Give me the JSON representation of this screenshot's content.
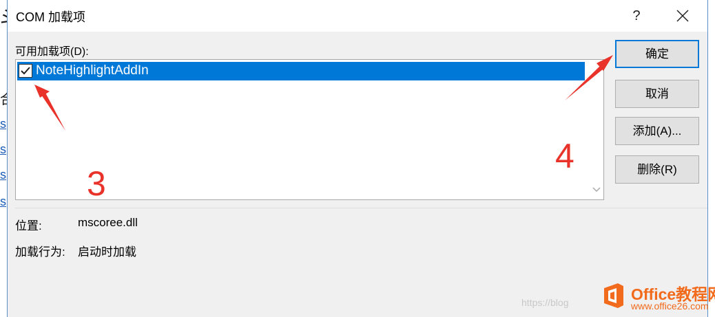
{
  "background": {
    "title_fragment": "斗",
    "text_fragment": "合",
    "link_fragments": [
      "s",
      "s",
      "s",
      "s"
    ]
  },
  "dialog": {
    "title": "COM 加载项",
    "help_label": "?",
    "close_label": "✕",
    "list_label": "可用加载项(D):",
    "items": [
      {
        "label": "NoteHighlightAddIn",
        "checked": true,
        "selected": true
      }
    ],
    "buttons": {
      "ok": "确定",
      "cancel": "取消",
      "add": "添加(A)...",
      "remove": "删除(R)"
    },
    "location_label": "位置:",
    "location_value": "mscoree.dll",
    "load_behavior_label": "加载行为:",
    "load_behavior_value": "启动时加载"
  },
  "annotations": {
    "step3": "3",
    "step4": "4",
    "color": "#e8322a"
  },
  "watermark": {
    "blog_text": "https://blog",
    "brand": "Office教程网",
    "url": "www.office26.com",
    "color": "#f26a1b"
  },
  "colors": {
    "selection": "#0078d7",
    "primary_border": "#0078d7"
  }
}
